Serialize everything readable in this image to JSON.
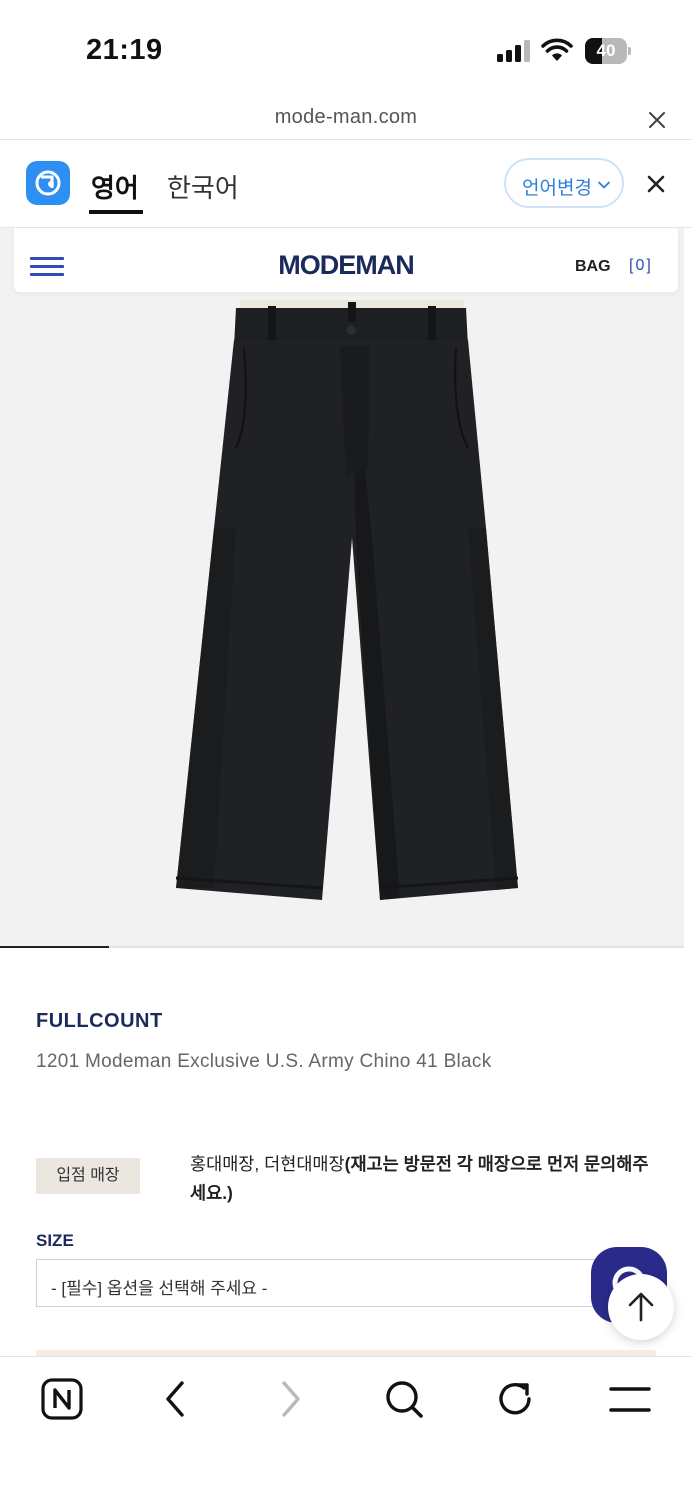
{
  "status_bar": {
    "time": "21:19",
    "battery_level": "40",
    "icons": [
      "signal-icon",
      "wifi-icon",
      "battery-icon"
    ]
  },
  "browser": {
    "url": "mode-man.com"
  },
  "translation_bar": {
    "tabs": [
      {
        "label": "영어",
        "active": true
      },
      {
        "label": "한국어",
        "active": false
      }
    ],
    "change_language_label": "언어변경",
    "accent_color": "#2e8ff3"
  },
  "site_header": {
    "logo": "MODEMAN",
    "bag_label": "BAG",
    "bag_count": "[0]",
    "brand_color": "#1a2a5c",
    "accent_color": "#2f4bb5"
  },
  "product": {
    "image_progress": 0.16,
    "brand": "FULLCOUNT",
    "title": "1201 Modeman Exclusive U.S. Army Chino 41 Black",
    "store_badge": "입점 매장",
    "store_text": "홍대매장, 더현대매장",
    "store_note": "(재고는 방문전 각 매장으로 먼저 문의해주세요.)",
    "size_label": "SIZE",
    "size_placeholder": "- [필수] 옵션을 선택해 주세요 -"
  },
  "toolbar": {
    "items": [
      "naver-home-icon",
      "back-icon",
      "forward-icon",
      "search-icon",
      "refresh-icon",
      "menu-icon"
    ]
  }
}
